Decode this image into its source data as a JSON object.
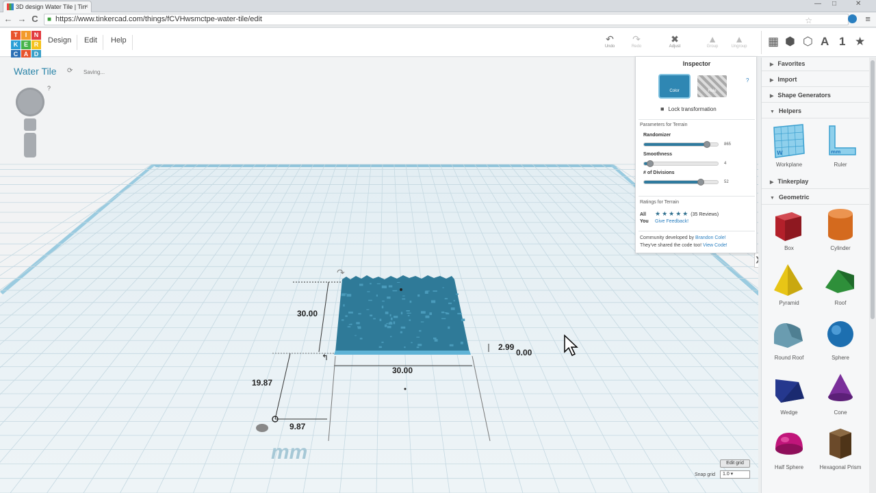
{
  "browser": {
    "tab_title": "3D design Water Tile | Tin",
    "tab_close": "×",
    "url": "https://www.tinkercad.com/things/fCVHwsmctpe-water-tile/edit",
    "win_min": "—",
    "win_max": "□",
    "win_close": "✕",
    "back": "←",
    "forward": "→",
    "reload": "C",
    "star": "☆",
    "menu": "≡"
  },
  "logo": [
    "T",
    "I",
    "N",
    "K",
    "E",
    "R",
    "C",
    "A",
    "D"
  ],
  "logo_colors": [
    "#e8532c",
    "#f39a2b",
    "#e23b3f",
    "#2a9fd6",
    "#46b34a",
    "#f5c21b",
    "#2b6fb5",
    "#e8532c",
    "#3aa0c8"
  ],
  "menu": {
    "design": "Design",
    "edit": "Edit",
    "help": "Help"
  },
  "tools": {
    "undo": "Undo",
    "undo_icon": "↶",
    "redo": "Redo",
    "redo_icon": "↷",
    "adjust": "Adjust",
    "adjust_icon": "✖",
    "group": "Group",
    "group_icon": "▲",
    "ungroup": "Ungroup",
    "ungroup_icon": "▲"
  },
  "view_icons": {
    "grid": "▦",
    "cube": "⬢",
    "cube2": "⬡",
    "text": "A",
    "number": "1",
    "fav": "★"
  },
  "design": {
    "title": "Water Tile",
    "status": "Saving...",
    "help": "?"
  },
  "dimensions": {
    "height_dim": "30.00",
    "width_dim": "30.00",
    "elev": "2.99",
    "zero": "0.00",
    "y_offset": "19.87",
    "x_offset": "9.87"
  },
  "units": "mm",
  "grid": {
    "edit_label": "Edit grid",
    "snap_label": "Snap grid",
    "snap_value": "1.0 ▾"
  },
  "inspector": {
    "title": "Inspector",
    "help": "?",
    "color_label": "Color",
    "hole_label": "Hole",
    "lock_icon": "🔒",
    "lock_label": "Lock transformation",
    "params_title": "Parameters for Terrain",
    "params": [
      {
        "label": "Randomizer",
        "value": "865",
        "fraction": 0.84
      },
      {
        "label": "Smoothness",
        "value": "4",
        "fraction": 0.08
      },
      {
        "label": "# of Divisions",
        "value": "52",
        "fraction": 0.75
      }
    ],
    "ratings_title": "Ratings for Terrain",
    "all_label": "All",
    "stars": "★★★★★",
    "reviews": "(35 Reviews)",
    "you_label": "You",
    "feedback_link": "Give Feedback!",
    "credit_line1": "Community developed by ",
    "credit_author": "Brandon Cole!",
    "credit_line2": "They've shared the code too! ",
    "credit_code": "View Code!"
  },
  "sidebar": {
    "favorites": "Favorites",
    "import": "Import",
    "shape_generators": "Shape Generators",
    "helpers": "Helpers",
    "tinkerplay": "Tinkerplay",
    "geometric": "Geometric",
    "collapsed_arrow": "▶",
    "expanded_arrow": "▼",
    "helpers_items": [
      "Workplane",
      "Ruler"
    ],
    "geometric_items": [
      "Box",
      "Cylinder",
      "Pyramid",
      "Roof",
      "Round Roof",
      "Sphere",
      "Wedge",
      "Cone",
      "Half Sphere",
      "Hexagonal Prism"
    ],
    "shape_colors": {
      "box": "#b3202a",
      "cylinder": "#d46a1e",
      "pyramid": "#e8c516",
      "roof": "#2e8f3a",
      "round_roof": "#6a9cb0",
      "sphere": "#1d6fb0",
      "wedge": "#25388e",
      "cone": "#7a2f9a",
      "half_sphere": "#c0157a",
      "hex_prism": "#6b4a2a"
    }
  },
  "collapse_arrow": "❯",
  "colors": {
    "accent": "#2b84a8",
    "tile": "#2f7a98",
    "grid_line": "#c9dde6"
  }
}
